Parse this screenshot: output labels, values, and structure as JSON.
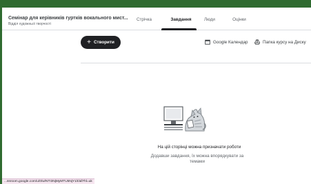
{
  "course": {
    "title": "Семінар для керівників гуртків вокального мист...",
    "subtitle": "Відділ художньої творчості"
  },
  "tabs": [
    {
      "label": "Стрічка",
      "active": false
    },
    {
      "label": "Завдання",
      "active": true
    },
    {
      "label": "Люди",
      "active": false
    },
    {
      "label": "Оцінки",
      "active": false
    }
  ],
  "toolbar": {
    "create_label": "Створити",
    "calendar_label": "Google Календар",
    "drive_label": "Папка курсу на Диску"
  },
  "empty_state": {
    "heading": "На цій сторінці можна призначати роботи",
    "line1": "Додавши завдання, їх можна впорядкувати за",
    "line2": "темами"
  },
  "status_bar": {
    "url": "...ssroom.google.com/u/0/w/NTI3NjMyMTU5NjY1/t/all?hl=uk"
  },
  "colors": {
    "frame_green": "#2f6b30",
    "primary_text": "#202124",
    "secondary_text": "#5f6368"
  }
}
